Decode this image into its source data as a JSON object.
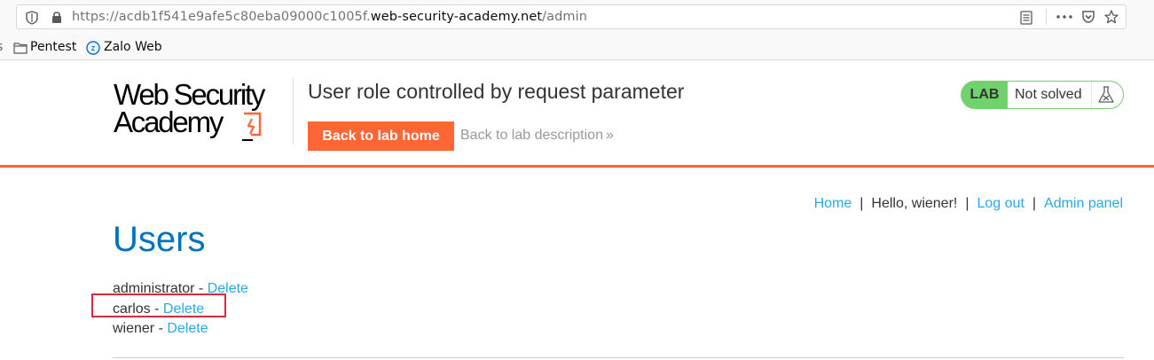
{
  "browser": {
    "url_prefix": "https://acdb1f541e9afe5c80eba09000c1005f.",
    "url_domain": "web-security-academy.net",
    "url_path": "/admin",
    "bookmarks": [
      {
        "label": "Pentest",
        "icon": "folder-icon"
      },
      {
        "label": "Zalo Web",
        "icon": "zalo-icon"
      }
    ]
  },
  "header": {
    "logo_line1": "Web Security",
    "logo_line2": "Academy",
    "lab_title": "User role controlled by request parameter",
    "back_button": "Back to lab home",
    "description_link": "Back to lab description",
    "lab_badge": "LAB",
    "lab_status": "Not solved"
  },
  "nav": {
    "home": "Home",
    "separator": "|",
    "greeting": "Hello, wiener!",
    "logout": "Log out",
    "admin": "Admin panel"
  },
  "main": {
    "title": "Users",
    "users": [
      {
        "name": "administrator",
        "dash": " - ",
        "action": "Delete"
      },
      {
        "name": "carlos",
        "dash": " - ",
        "action": "Delete"
      },
      {
        "name": "wiener",
        "dash": " - ",
        "action": "Delete"
      }
    ]
  },
  "colors": {
    "accent_orange": "#ff6633",
    "link_blue": "#29a9e1",
    "title_blue": "#0071bc",
    "lab_green": "#70d16d",
    "highlight_red": "#d42b3f"
  }
}
